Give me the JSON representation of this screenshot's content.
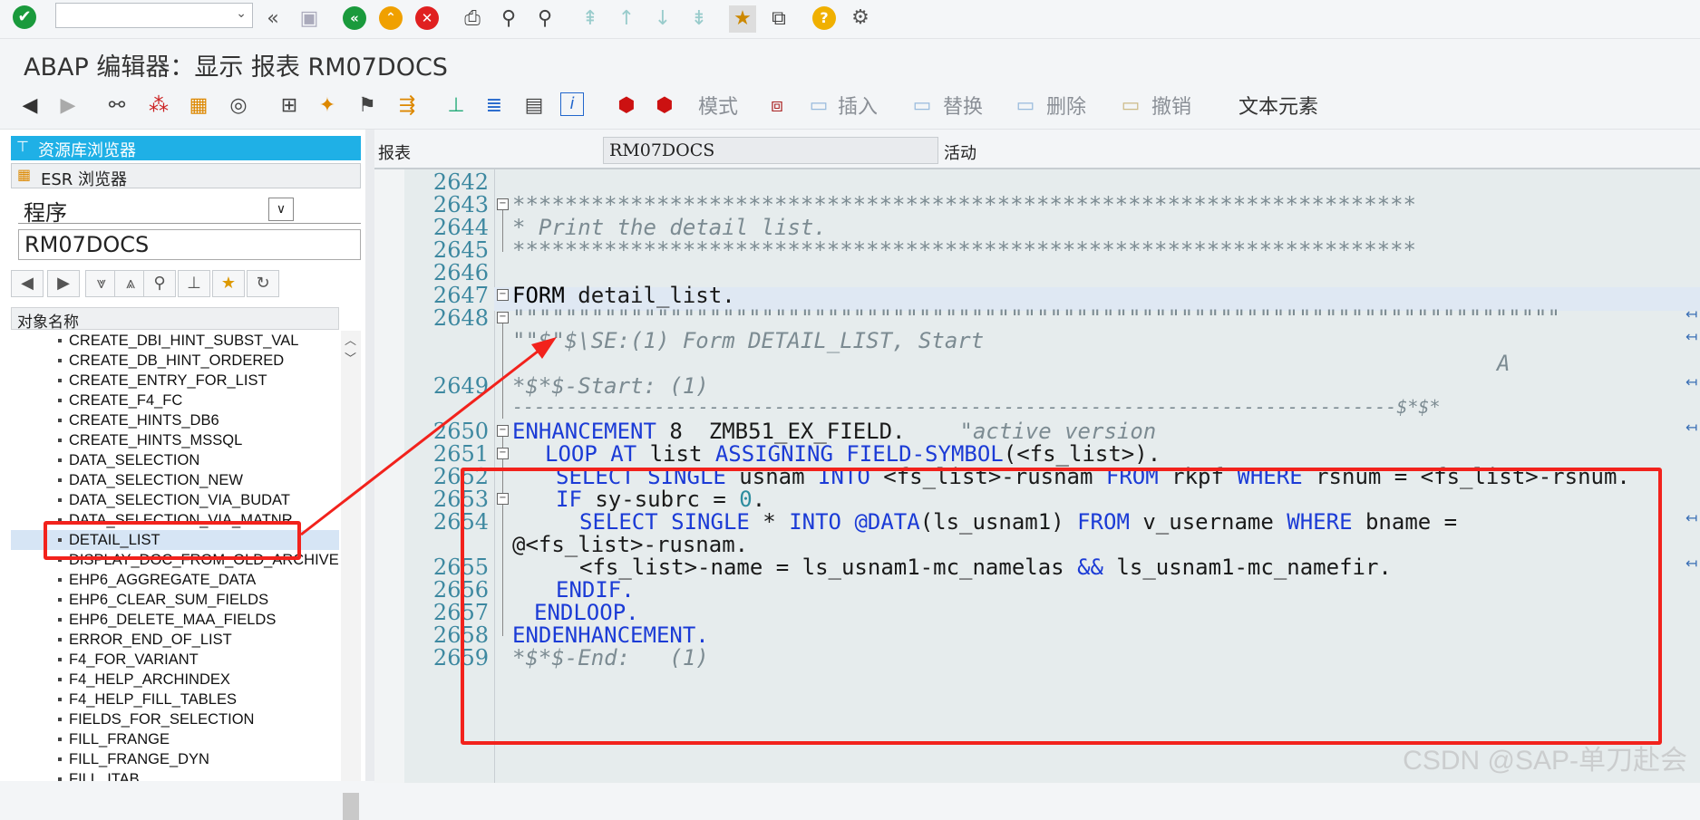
{
  "toolbar1": {
    "icons": [
      "check-icon",
      "back-double-icon",
      "save-icon",
      "green-back-icon",
      "up-icon",
      "cancel-icon",
      "print-icon",
      "find-icon",
      "find-next-icon",
      "page-first-icon",
      "page-prev-icon",
      "page-next-icon",
      "page-last-icon",
      "layout-icon",
      "shortcut-icon",
      "help-icon",
      "settings-icon"
    ]
  },
  "title": "ABAP 编辑器：显示 报表 RM07DOCS",
  "toolbar2": {
    "mode_label": "模式",
    "insert_label": "插入",
    "replace_label": "替换",
    "delete_label": "删除",
    "undo_label": "撤销",
    "text_elements_label": "文本元素"
  },
  "left": {
    "repo_browser": "资源库浏览器",
    "esr_browser": "ESR 浏览器",
    "object_type": "程序",
    "object_name": "RM07DOCS",
    "column_header": "对象名称",
    "tree_items": [
      "CREATE_DBI_HINT_SUBST_VAL",
      "CREATE_DB_HINT_ORDERED",
      "CREATE_ENTRY_FOR_LIST",
      "CREATE_F4_FC",
      "CREATE_HINTS_DB6",
      "CREATE_HINTS_MSSQL",
      "DATA_SELECTION",
      "DATA_SELECTION_NEW",
      "DATA_SELECTION_VIA_BUDAT",
      "DATA_SELECTION_VIA_MATNR",
      "DETAIL_LIST",
      "DISPLAY_DOC_FROM_OLD_ARCHIVE",
      "EHP6_AGGREGATE_DATA",
      "EHP6_CLEAR_SUM_FIELDS",
      "EHP6_DELETE_MAA_FIELDS",
      "ERROR_END_OF_LIST",
      "F4_FOR_VARIANT",
      "F4_HELP_ARCHINDEX",
      "F4_HELP_FILL_TABLES",
      "FIELDS_FOR_SELECTION",
      "FILL_FRANGE",
      "FILL_FRANGE_DYN",
      "FILL_ITAB"
    ]
  },
  "right": {
    "report_label": "报表",
    "report_value": "RM07DOCS",
    "status_label": "活动"
  },
  "editor": {
    "line_numbers": [
      "2642",
      "2643",
      "2644",
      "2645",
      "2646",
      "2647",
      "2648",
      "2649",
      "2650",
      "2651",
      "2652",
      "2653",
      "2654",
      "2655",
      "2656",
      "2657",
      "2658",
      "2659"
    ],
    "code": {
      "l2643": "*********************************************************************",
      "l2644": "* Print the detail list.",
      "l2645": "*********************************************************************",
      "l2647a": "FORM",
      "l2647b": " detail_list.",
      "l2648": "\"\"\"\"\"\"\"\"\"\"\"\"\"\"\"\"\"\"\"\"\"\"\"\"\"\"\"\"\"\"\"\"\"\"\"\"\"\"\"\"\"\"\"\"\"\"\"\"\"\"\"\"\"\"\"\"\"\"\"\"\"\"\"\"\"\"\"\"\"\"\"\"\"\"\"\"\"\"\"\"",
      "l2648b": "\"\"$\"$\\SE:(1) Form DETAIL_LIST, Start",
      "l2648c": "A",
      "l2649": "*$*$-Start: (1)",
      "l2649b": "---------------------------------------------------------------------------------$*$*",
      "l2650a": "ENHANCEMENT",
      "l2650b": " 8  ZMB51_EX_FIELD.",
      "l2650c": "\"active version",
      "l2651a": "LOOP AT",
      "l2651b": " list ",
      "l2651c": "ASSIGNING FIELD-SYMBOL",
      "l2651d": "(<fs_list>).",
      "l2652a": "SELECT SINGLE",
      "l2652b": " usnam ",
      "l2652c": "INTO",
      "l2652d": " <fs_list>-rusnam ",
      "l2652e": "FROM",
      "l2652f": " rkpf ",
      "l2652g": "WHERE",
      "l2652h": " rsnum = <fs_list>-rsnum.",
      "l2653a": "IF",
      "l2653b": " sy-subrc = ",
      "l2653c": "0",
      "l2653d": ".",
      "l2654a": "SELECT SINGLE",
      "l2654b": " * ",
      "l2654c": "INTO @DATA",
      "l2654d": "(ls_usnam1) ",
      "l2654e": "FROM",
      "l2654f": " v_username ",
      "l2654g": "WHERE",
      "l2654h": " bname =",
      "l2654i": "@<fs_list>-rusnam.",
      "l2655a": "<fs_list>-name = ls_usnam1-mc_namelas ",
      "l2655b": "&&",
      "l2655c": " ls_usnam1-mc_namefir.",
      "l2656": "ENDIF.",
      "l2657": "ENDLOOP.",
      "l2658": "ENDENHANCEMENT.",
      "l2659": "*$*$-End:   (1)"
    }
  },
  "watermark": "CSDN @SAP-单刀赴会",
  "colors": {
    "keyword": "#1b3bd6",
    "comment": "#7c8b92",
    "annotation": "#f2221c",
    "selection": "#1fb0e6"
  }
}
